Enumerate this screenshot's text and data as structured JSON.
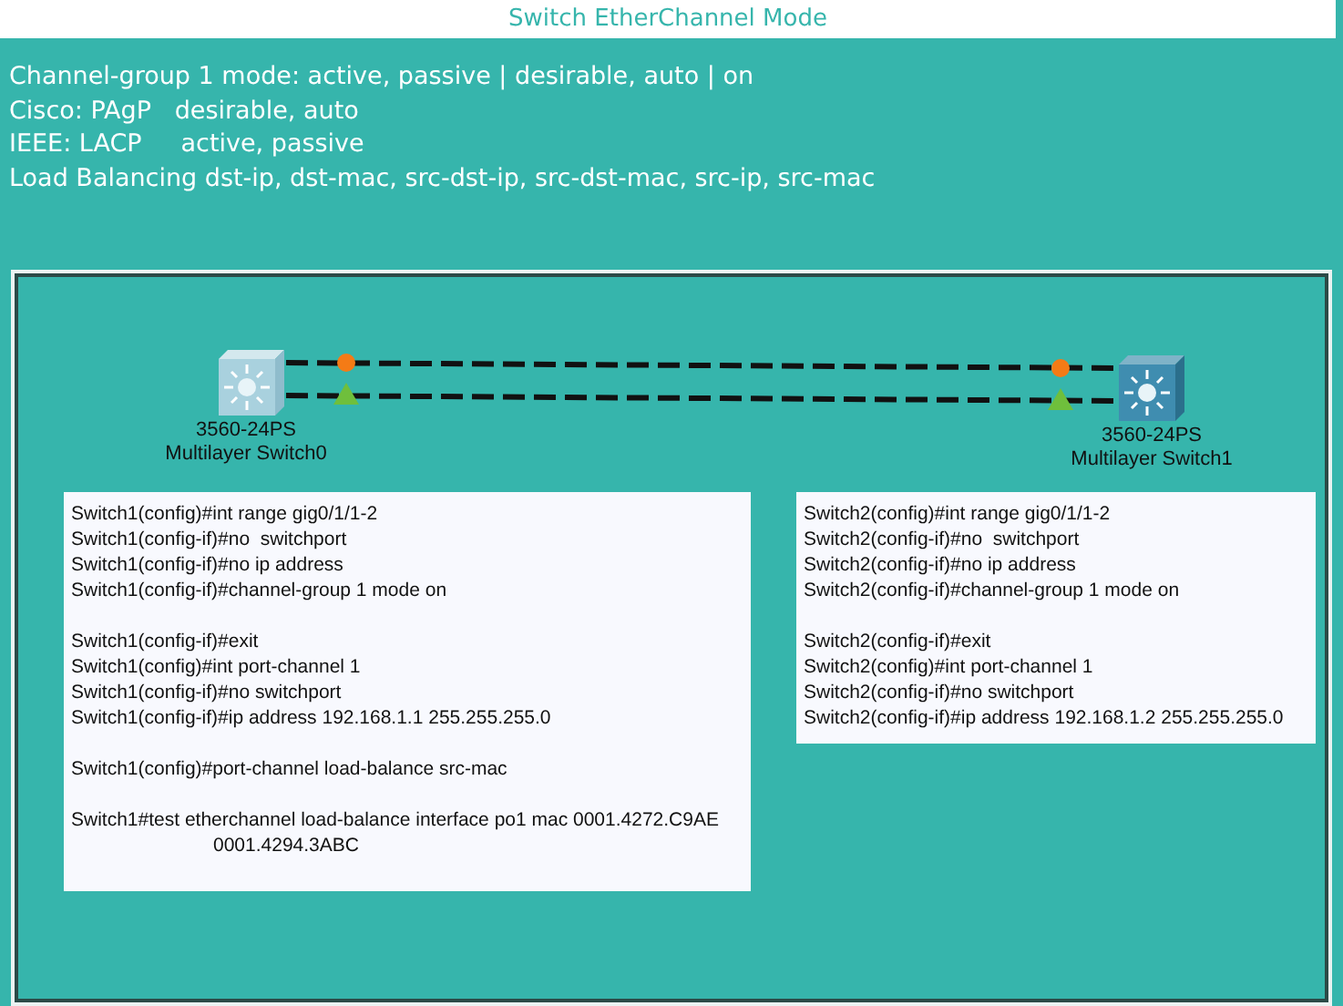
{
  "title": "Switch EtherChannel Mode",
  "notes": [
    "Channel-group 1 mode: active, passive | desirable, auto | on",
    "Cisco: PAgP   desirable, auto",
    "IEEE: LACP     active, passive",
    "Load Balancing dst-ip, dst-mac, src-dst-ip, src-dst-mac, src-ip, src-mac"
  ],
  "devices": [
    {
      "model": "3560-24PS",
      "name": "Multilayer Switch0",
      "selected": false
    },
    {
      "model": "3560-24PS",
      "name": "Multilayer Switch1",
      "selected": true
    }
  ],
  "links": [
    {
      "up": false
    },
    {
      "up": true
    }
  ],
  "consoles": [
    {
      "lines": [
        {
          "kind": "command",
          "text": "Switch1(config)#int range gig0/1/1-2"
        },
        {
          "kind": "command",
          "text": "Switch1(config-if)#no  switchport"
        },
        {
          "kind": "command",
          "text": "Switch1(config-if)#no ip address"
        },
        {
          "kind": "command",
          "text": "Switch1(config-if)#channel-group 1 mode on"
        },
        {
          "kind": "gap"
        },
        {
          "kind": "command",
          "text": "Switch1(config-if)#exit"
        },
        {
          "kind": "command",
          "text": "Switch1(config)#int port-channel 1"
        },
        {
          "kind": "command",
          "text": "Switch1(config-if)#no switchport"
        },
        {
          "kind": "command",
          "text": "Switch1(config-if)#ip address 192.168.1.1 255.255.255.0"
        },
        {
          "kind": "gap"
        },
        {
          "kind": "command",
          "text": "Switch1(config)#port-channel load-balance src-mac"
        },
        {
          "kind": "gap"
        },
        {
          "kind": "command",
          "text": "Switch1#test etherchannel load-balance interface po1 mac 0001.4272.C9AE"
        },
        {
          "kind": "continuation",
          "text": "0001.4294.3ABC"
        }
      ]
    },
    {
      "lines": [
        {
          "kind": "command",
          "text": "Switch2(config)#int range gig0/1/1-2"
        },
        {
          "kind": "command",
          "text": "Switch2(config-if)#no  switchport"
        },
        {
          "kind": "command",
          "text": "Switch2(config-if)#no ip address"
        },
        {
          "kind": "command",
          "text": "Switch2(config-if)#channel-group 1 mode on"
        },
        {
          "kind": "gap"
        },
        {
          "kind": "command",
          "text": "Switch2(config-if)#exit"
        },
        {
          "kind": "command",
          "text": "Switch2(config)#int port-channel 1"
        },
        {
          "kind": "command",
          "text": "Switch2(config-if)#no switchport"
        },
        {
          "kind": "command",
          "text": "Switch2(config-if)#ip address 192.168.1.2 255.255.255.0"
        }
      ]
    }
  ]
}
